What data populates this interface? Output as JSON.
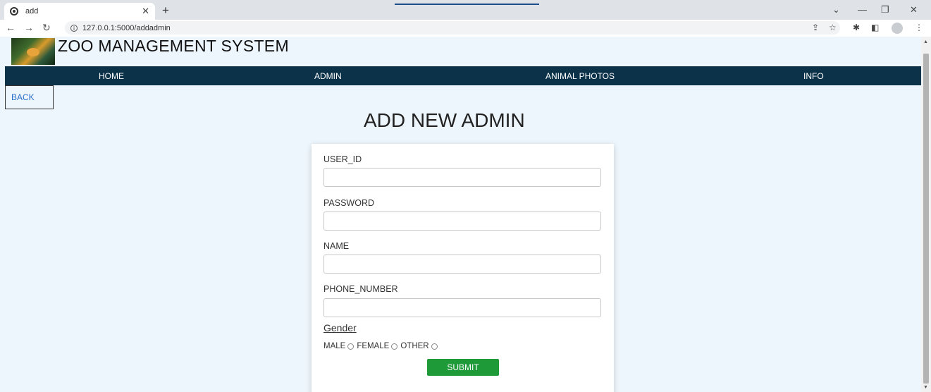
{
  "browser": {
    "tab_title": "add",
    "url": "127.0.0.1:5000/addadmin"
  },
  "site": {
    "title": "ZOO MANAGEMENT SYSTEM"
  },
  "nav": {
    "items": [
      {
        "label": "HOME"
      },
      {
        "label": "ADMIN"
      },
      {
        "label": "ANIMAL PHOTOS"
      },
      {
        "label": "INFO"
      }
    ]
  },
  "back_label": "BACK",
  "form": {
    "title": "ADD NEW ADMIN",
    "fields": [
      {
        "label": "USER_ID",
        "value": ""
      },
      {
        "label": "PASSWORD",
        "value": ""
      },
      {
        "label": "NAME",
        "value": ""
      },
      {
        "label": "PHONE_NUMBER",
        "value": ""
      }
    ],
    "gender_label": "Gender",
    "gender_options": [
      "MALE",
      "FEMALE",
      "OTHER"
    ],
    "submit_label": "SUBMIT"
  },
  "colors": {
    "navbar": "#0b3249",
    "submit": "#1e9a38",
    "link": "#2a6fc9",
    "page_bg": "#eef6fd"
  }
}
